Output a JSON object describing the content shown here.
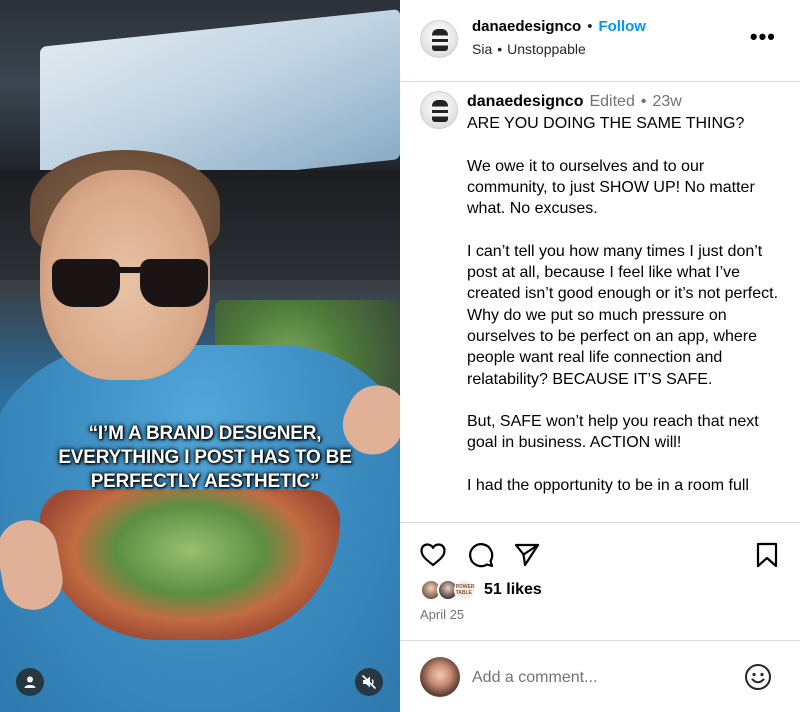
{
  "media": {
    "caption": "“I’M A BRAND DESIGNER,\nEVERYTHING I POST HAS TO BE\nPERFECTLY AESTHETIC”"
  },
  "header": {
    "username": "danaedesignco",
    "follow_label": "Follow",
    "audio_artist": "Sia",
    "audio_track": "Unstoppable",
    "more_label": "•••"
  },
  "post": {
    "username": "danaedesignco",
    "edited_label": "Edited",
    "age": "23w",
    "text": "ARE YOU DOING THE SAME THING?\n\nWe owe it to ourselves and to our community, to just SHOW UP! No matter what. No excuses.\n\nI can’t tell you how many times I just don’t post at all, because I feel like what I’ve created isn’t good enough or it’s not perfect. Why do we put so much pressure on ourselves to be perfect on an app, where people want real life connection and relatability? BECAUSE IT’S SAFE.\n\nBut, SAFE won’t help you reach that next goal in business. ACTION will!\n\nI had the opportunity to be in a room full"
  },
  "actions": {
    "icons": [
      "heart-icon",
      "comment-icon",
      "share-icon",
      "bookmark-icon"
    ],
    "likes": "51 likes",
    "liker_badge_text": "POWER\nTABLE",
    "date": "April 25"
  },
  "comment": {
    "placeholder": "Add a comment..."
  },
  "colors": {
    "follow": "#0095f6",
    "muted": "#737373",
    "divider": "#dbdbdb"
  }
}
